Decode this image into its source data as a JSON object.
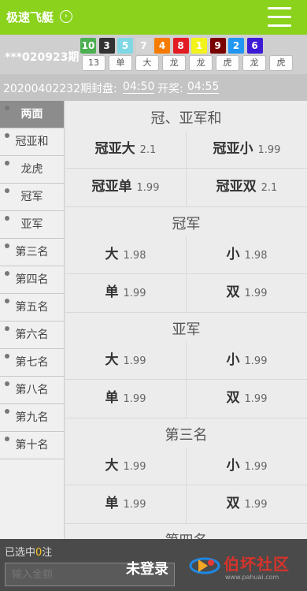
{
  "header": {
    "title": "极速飞艇",
    "arrow_icon": "chevron-right-icon",
    "menu_icon": "hamburger-menu-icon"
  },
  "last_draw": {
    "issue_label": "***020923期",
    "balls": [
      {
        "num": "10",
        "color": "#4caf50"
      },
      {
        "num": "3",
        "color": "#333333"
      },
      {
        "num": "5",
        "color": "#7fd8e4"
      },
      {
        "num": "7",
        "color": "#d4d4d4"
      },
      {
        "num": "4",
        "color": "#f57c00"
      },
      {
        "num": "8",
        "color": "#e31b23"
      },
      {
        "num": "1",
        "color": "#f3f31c"
      },
      {
        "num": "9",
        "color": "#7a0000"
      },
      {
        "num": "2",
        "color": "#2196f3"
      },
      {
        "num": "6",
        "color": "#3d1ad6"
      }
    ],
    "attrs": [
      "13",
      "单",
      "大",
      "龙",
      "龙",
      "虎",
      "龙",
      "虎"
    ]
  },
  "timing": {
    "issue": "20200402232期封盘:",
    "close_time": "04:50",
    "open_label": "开奖:",
    "open_time": "04:55"
  },
  "sidebar": {
    "items": [
      {
        "label": "两面",
        "active": true
      },
      {
        "label": "冠亚和"
      },
      {
        "label": "龙虎"
      },
      {
        "label": "冠军"
      },
      {
        "label": "亚军"
      },
      {
        "label": "第三名"
      },
      {
        "label": "第四名"
      },
      {
        "label": "第五名"
      },
      {
        "label": "第六名"
      },
      {
        "label": "第七名"
      },
      {
        "label": "第八名"
      },
      {
        "label": "第九名"
      },
      {
        "label": "第十名"
      }
    ]
  },
  "sections": [
    {
      "title": "冠、亚军和",
      "bets": [
        {
          "name": "冠亚大",
          "odds": "2.1"
        },
        {
          "name": "冠亚小",
          "odds": "1.99"
        },
        {
          "name": "冠亚单",
          "odds": "1.99"
        },
        {
          "name": "冠亚双",
          "odds": "2.1"
        }
      ]
    },
    {
      "title": "冠军",
      "bets": [
        {
          "name": "大",
          "odds": "1.98"
        },
        {
          "name": "小",
          "odds": "1.98"
        },
        {
          "name": "单",
          "odds": "1.99"
        },
        {
          "name": "双",
          "odds": "1.99"
        }
      ]
    },
    {
      "title": "亚军",
      "bets": [
        {
          "name": "大",
          "odds": "1.99"
        },
        {
          "name": "小",
          "odds": "1.99"
        },
        {
          "name": "单",
          "odds": "1.99"
        },
        {
          "name": "双",
          "odds": "1.99"
        }
      ]
    },
    {
      "title": "第三名",
      "bets": [
        {
          "name": "大",
          "odds": "1.99"
        },
        {
          "name": "小",
          "odds": "1.99"
        },
        {
          "name": "单",
          "odds": "1.99"
        },
        {
          "name": "双",
          "odds": "1.99"
        }
      ]
    },
    {
      "title": "第四名",
      "bets": []
    }
  ],
  "footer": {
    "selected_prefix": "已选中",
    "selected_count": "0",
    "selected_suffix": "注",
    "amount_placeholder": "输入金额",
    "login_label": "未登录",
    "watermark_brand": "伯坏社区",
    "watermark_url": "www.pahuai.com"
  }
}
